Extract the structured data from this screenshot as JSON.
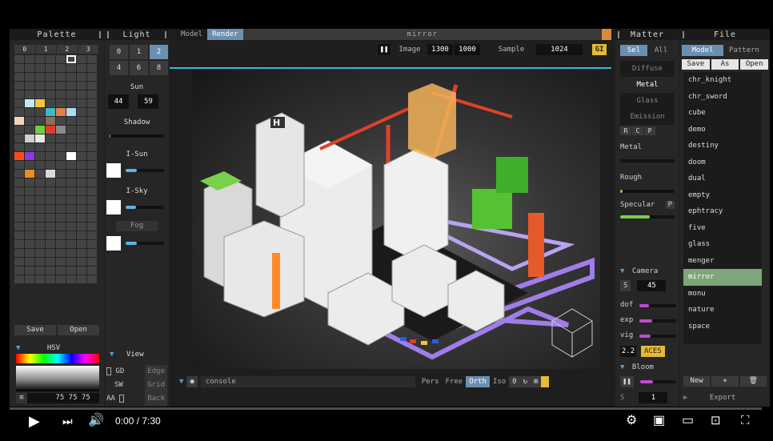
{
  "palette": {
    "title": "Palette",
    "tabs": [
      "0",
      "1",
      "2",
      "3"
    ],
    "save": "Save",
    "open": "Open",
    "hsv_label": "HSV",
    "hsv_value": "75 75 75",
    "colors": [
      "#444444",
      "#c7e6f2",
      "#f4c542",
      "#3fb8c9",
      "#e0804a",
      "#b2d9f0",
      "#f2d4c0",
      "#8a6d5a",
      "#6bd13f",
      "#e23a2e",
      "#8a8a8a",
      "#cfcfcf",
      "#e8e8e8",
      "#ff4a1a",
      "#8a38e0",
      "#ffffff",
      "#f08a24",
      "#dadada"
    ]
  },
  "light": {
    "title": "Light",
    "buttons": [
      "0",
      "1",
      "2",
      "4",
      "6",
      "8"
    ],
    "sun_label": "Sun",
    "sun_values": [
      "44",
      "59"
    ],
    "shadow_label": "Shadow",
    "isun_label": "I-Sun",
    "isky_label": "I-Sky",
    "fog_label": "Fog",
    "shadow_level": 0.02,
    "isun_level": 0.3,
    "isky_level": 0.28,
    "fog_level": 0.3
  },
  "view": {
    "title": "View",
    "rows": [
      [
        "GD",
        "Edge"
      ],
      [
        "SW",
        "Grid"
      ],
      [
        "AA",
        "Back"
      ]
    ]
  },
  "viewport": {
    "tabs": [
      "Model",
      "Render"
    ],
    "title": "mirror",
    "image_label": "Image",
    "image_w": "1300",
    "image_h": "1000",
    "sample_label": "Sample",
    "sample_value": "1024",
    "gi_label": "GI",
    "console_placeholder": "console",
    "modes": [
      "Pers",
      "Free",
      "Orth",
      "Iso"
    ],
    "zero": "0"
  },
  "matter": {
    "title": "Matter",
    "tabs": [
      "Sel",
      "All"
    ],
    "types": [
      "Diffuse",
      "Metal",
      "Glass",
      "Emission"
    ],
    "rcp": [
      "R",
      "C",
      "P"
    ],
    "metal_label": "Metal",
    "rough_label": "Rough",
    "specular_label": "Specular",
    "p_label": "P",
    "metal_level": 0.0,
    "rough_level": 0.05,
    "specular_level": 0.55,
    "camera_label": "Camera",
    "camera_s": "S",
    "camera_fov": "45",
    "dof_label": "dof",
    "exp_label": "exp",
    "vig_label": "vig",
    "dof_level": 0.25,
    "exp_level": 0.35,
    "vig_level": 0.3,
    "tone_value": "2.2",
    "aces_label": "ACES",
    "bloom_label": "Bloom",
    "bloom_level": 0.35,
    "bloom_s": "S",
    "bloom_value": "1"
  },
  "file": {
    "title": "File",
    "tabs": [
      "Model",
      "Pattern"
    ],
    "actions": [
      "Save",
      "As",
      "Open"
    ],
    "items": [
      "chr_knight",
      "chr_sword",
      "cube",
      "demo",
      "destiny",
      "doom",
      "dual",
      "empty",
      "ephtracy",
      "five",
      "glass",
      "menger",
      "mirror",
      "monu",
      "nature",
      "space"
    ],
    "selected": "mirror",
    "new_label": "New",
    "plus": "+",
    "export_label": "Export"
  },
  "player": {
    "time": "0:00 / 7:30"
  }
}
